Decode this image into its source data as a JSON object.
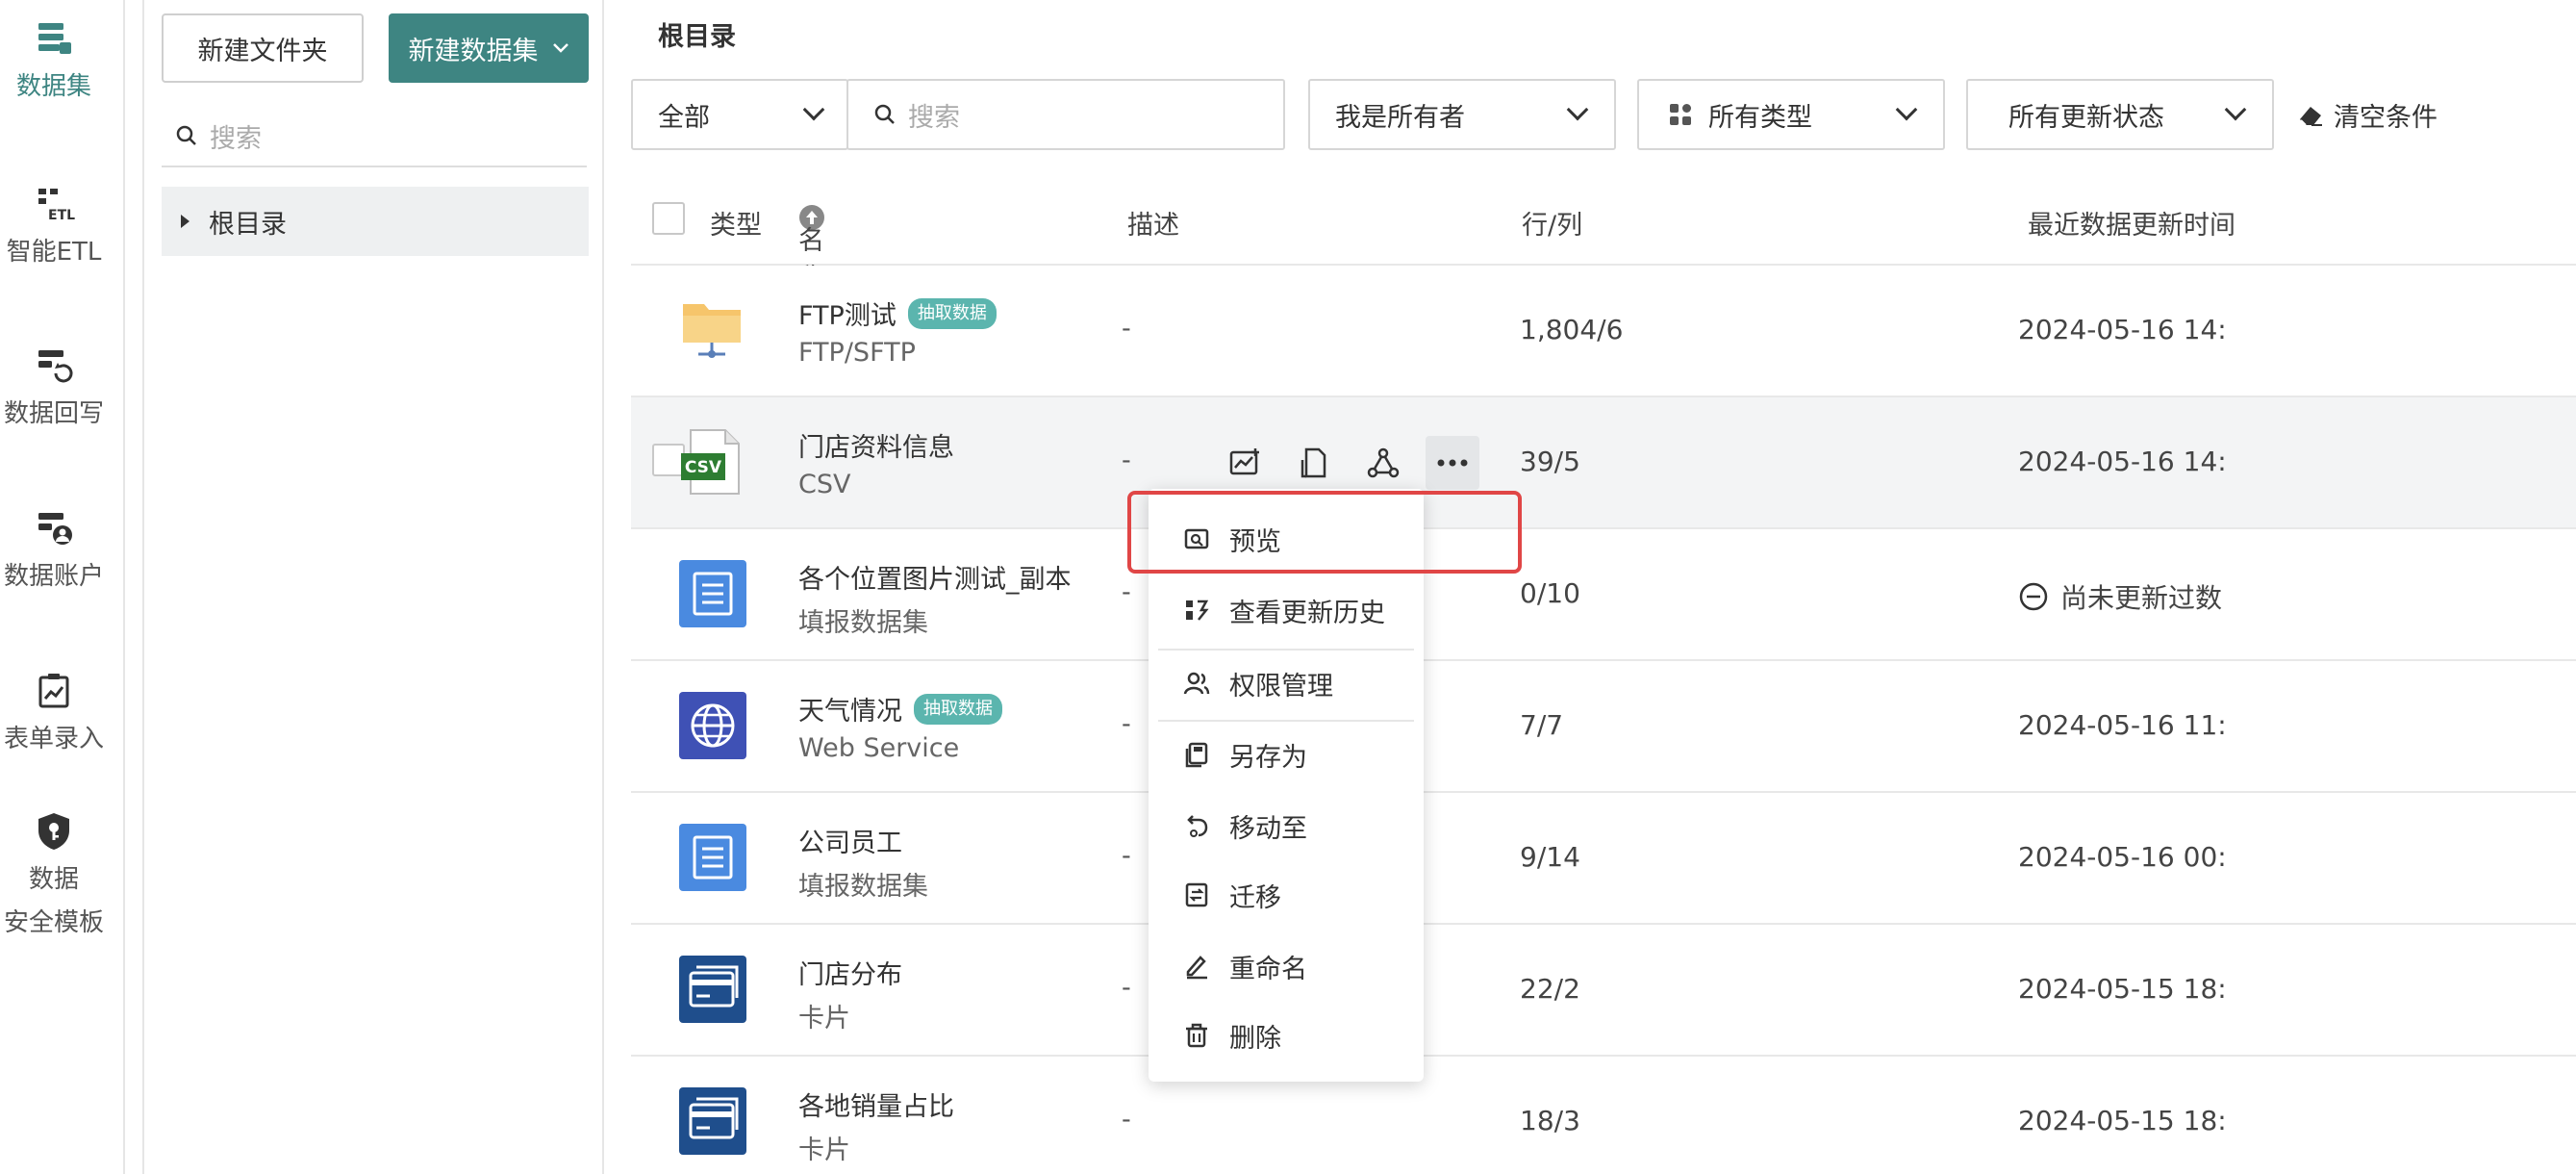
{
  "nav": {
    "items": [
      {
        "label": "数据集",
        "icon": "dataset-icon"
      },
      {
        "label": "智能ETL",
        "icon": "etl-icon"
      },
      {
        "label": "数据回写",
        "icon": "writeback-icon"
      },
      {
        "label": "数据账户",
        "icon": "data-account-icon"
      },
      {
        "label": "表单录入",
        "icon": "form-entry-icon"
      },
      {
        "label_line1": "数据",
        "label_line2": "安全模板",
        "icon": "security-shield-icon"
      }
    ],
    "active_color": "#3e8582"
  },
  "folder_pane": {
    "new_folder": "新建文件夹",
    "new_dataset": "新建数据集",
    "search_placeholder": "搜索",
    "root": "根目录"
  },
  "main": {
    "breadcrumb": "根目录",
    "filters": {
      "scope": "全部",
      "search_placeholder": "搜索",
      "owner": "我是所有者",
      "type": "所有类型",
      "update_status": "所有更新状态",
      "clear": "清空条件"
    },
    "columns": {
      "type": "类型",
      "name": "名称",
      "desc": "描述",
      "rowcol": "行/列",
      "updated": "最近数据更新时间"
    },
    "rows": [
      {
        "name": "FTP测试",
        "badge": "抽取数据",
        "sub": "FTP/SFTP",
        "desc": "-",
        "rowcol": "1,804/6",
        "updated": "2024-05-16 14:",
        "icon": "ftp-folder-icon"
      },
      {
        "name": "门店资料信息",
        "badge": "",
        "sub": "CSV",
        "desc": "-",
        "rowcol": "39/5",
        "updated": "2024-05-16 14:",
        "icon": "csv-icon"
      },
      {
        "name": "各个位置图片测试_副本",
        "badge": "",
        "sub": "填报数据集",
        "desc": "-",
        "rowcol": "0/10",
        "updated": "尚未更新过数",
        "icon": "form-dataset-icon"
      },
      {
        "name": "天气情况",
        "badge": "抽取数据",
        "sub": "Web Service",
        "desc": "-",
        "rowcol": "7/7",
        "updated": "2024-05-16 11:",
        "icon": "web-service-icon"
      },
      {
        "name": "公司员工",
        "badge": "",
        "sub": "填报数据集",
        "desc": "-",
        "rowcol": "9/14",
        "updated": "2024-05-16 00:",
        "icon": "form-dataset-icon"
      },
      {
        "name": "门店分布",
        "badge": "",
        "sub": "卡片",
        "desc": "-",
        "rowcol": "22/2",
        "updated": "2024-05-15 18:",
        "icon": "card-icon"
      },
      {
        "name": "各地销量占比",
        "badge": "",
        "sub": "卡片",
        "desc": "-",
        "rowcol": "18/3",
        "updated": "2024-05-15 18:",
        "icon": "card-icon"
      }
    ],
    "csv_label": "CSV"
  },
  "menu": {
    "items": [
      {
        "label": "预览",
        "icon": "preview-icon"
      },
      {
        "label": "查看更新历史",
        "icon": "history-icon"
      },
      {
        "label": "权限管理",
        "icon": "permission-icon"
      },
      {
        "label": "另存为",
        "icon": "save-as-icon"
      },
      {
        "label": "移动至",
        "icon": "move-to-icon"
      },
      {
        "label": "迁移",
        "icon": "migrate-icon"
      },
      {
        "label": "重命名",
        "icon": "rename-icon"
      },
      {
        "label": "删除",
        "icon": "delete-icon"
      }
    ]
  }
}
